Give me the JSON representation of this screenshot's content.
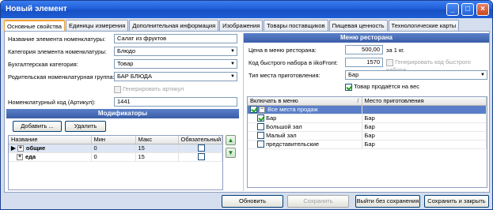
{
  "window": {
    "title": "Новый элемент"
  },
  "tabs": [
    "Основные свойства",
    "Единицы измерения",
    "Дополнительная информация",
    "Изображения",
    "Товары поставщиков",
    "Пищевая ценность",
    "Технологические карты"
  ],
  "main": {
    "name_label": "Название элемента номенклатуры:",
    "name_value": "Салат из фруктов",
    "category_label": "Категория элемента номенклатуры:",
    "category_value": "Блюдо",
    "acc_category_label": "Бухгалтерская категория:",
    "acc_category_value": "Товар",
    "parent_group_label": "Родительская номенклатурная группа:",
    "parent_group_value": "БАР БЛЮДА",
    "generate_article_label": "Генерировать артикул",
    "article_label": "Номенклатурный код (Артикул):",
    "article_value": "1441"
  },
  "modifiers": {
    "header": "Модификаторы",
    "add_button": "Добавить ...",
    "delete_button": "Удалить",
    "columns": [
      "Название",
      "Мин",
      "Макс",
      "Обязательный"
    ],
    "rows": [
      {
        "name": "общие",
        "min": "0",
        "max": "15",
        "required": false
      },
      {
        "name": "еда",
        "min": "0",
        "max": "15",
        "required": false
      }
    ]
  },
  "menu": {
    "header": "Меню ресторана",
    "price_label": "Цена в меню ресторана:",
    "price_value": "500,00",
    "price_unit": "за 1 кг.",
    "quick_code_label": "Код быстрого набора в iikoFront:",
    "quick_code_value": "1570",
    "generate_quick_code_label": "Генерировать код быстрого набора",
    "prep_place_label": "Тип места приготовления:",
    "prep_place_value": "Бар",
    "sold_by_weight_label": "Товар продаётся на вес",
    "sold_by_weight": true,
    "columns": [
      "Включать в меню",
      "Место приготовления"
    ],
    "rows": [
      {
        "name": "Все места продаж",
        "place": "",
        "checked": true,
        "level": 0,
        "selected": true
      },
      {
        "name": "Бар",
        "place": "Бар",
        "checked": true,
        "level": 1,
        "selected": false
      },
      {
        "name": "Большой зал",
        "place": "Бар",
        "checked": false,
        "level": 1,
        "selected": false
      },
      {
        "name": "Малый зал",
        "place": "Бар",
        "checked": false,
        "level": 1,
        "selected": false
      },
      {
        "name": "представительские",
        "place": "Бар",
        "checked": false,
        "level": 1,
        "selected": false
      }
    ]
  },
  "footer": {
    "update": "Обновить",
    "save": "Сохранить",
    "exit_no_save": "Выйти без сохранения",
    "save_close": "Сохранить и закрыть"
  }
}
